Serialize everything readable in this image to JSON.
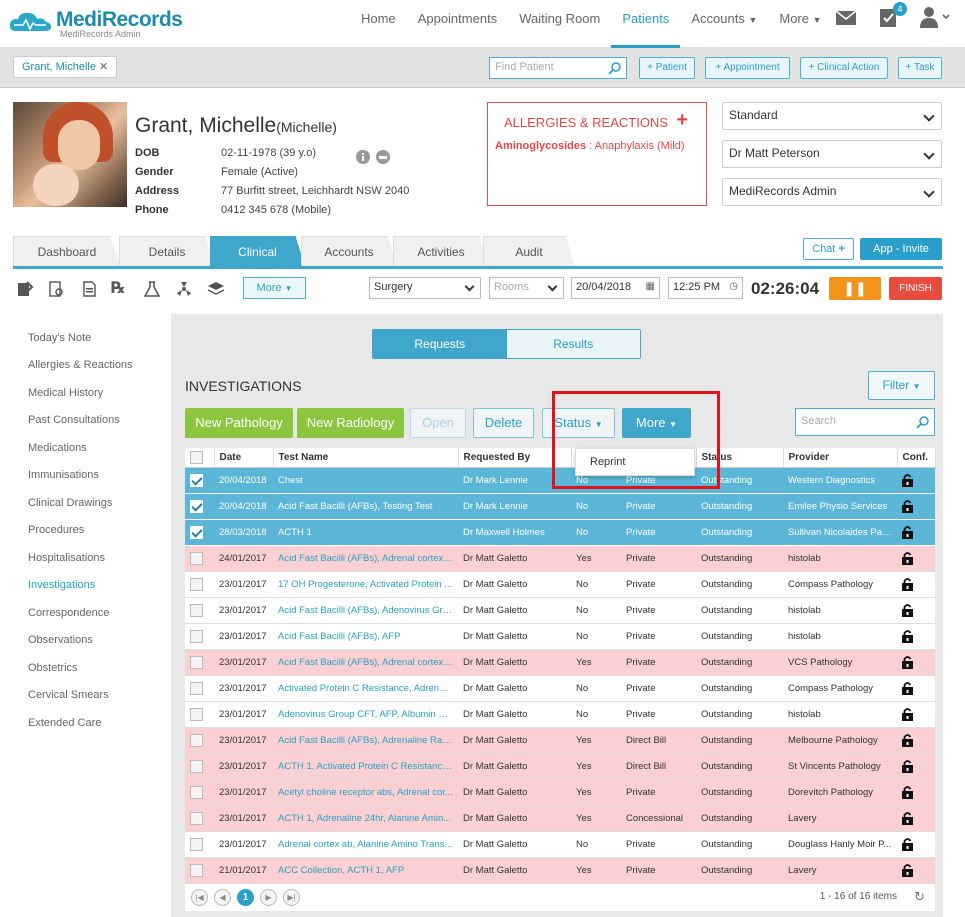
{
  "app": {
    "name": "MediRecords",
    "sub": "MediRecords Admin"
  },
  "nav": {
    "items": [
      "Home",
      "Appointments",
      "Waiting Room",
      "Patients",
      "Accounts",
      "More"
    ],
    "active": "Patients",
    "notifications": "4"
  },
  "bar2": {
    "patient_tab": "Grant, Michelle",
    "find_placeholder": "Find Patient",
    "btn_patient": "+ Patient",
    "btn_appointment": "+ Appointment",
    "btn_clinical": "+ Clinical Action",
    "btn_task": "+ Task"
  },
  "patient": {
    "name": "Grant, Michelle",
    "preferred": "(Michelle)",
    "dob_label": "DOB",
    "dob": "02-11-1978 (39 y.o)",
    "gender_label": "Gender",
    "gender": "Female (Active)",
    "address_label": "Address",
    "address": "77 Burfitt street, Leichhardt NSW 2040",
    "phone_label": "Phone",
    "phone": "0412 345 678 (Mobile)"
  },
  "allergies": {
    "title": "ALLERGIES & REACTIONS",
    "item_name": "Aminoglycosides",
    "item_detail": " : Anaphylaxis (Mild)"
  },
  "selects": {
    "billing": "Standard",
    "doctor": "Dr Matt Peterson",
    "location": "MediRecords Admin"
  },
  "tabs": [
    "Dashboard",
    "Details",
    "Clinical",
    "Accounts",
    "Activities",
    "Audit"
  ],
  "chat_label": "Chat",
  "invite_label": "App - Invite",
  "toolbar": {
    "more": "More",
    "surgery": "Surgery",
    "rooms": "Rooms",
    "date": "20/04/2018",
    "time": "12:25 PM",
    "timer": "02:26:04",
    "finish": "FINISH"
  },
  "sidebar": [
    "Today's Note",
    "Allergies & Reactions",
    "Medical History",
    "Past Consultations",
    "Medications",
    "Immunisations",
    "Clinical Drawings",
    "Procedures",
    "Hospitalisations",
    "Investigations",
    "Correspondence",
    "Observations",
    "Obstetrics",
    "Cervical Smears",
    "Extended Care"
  ],
  "sidebar_active": "Investigations",
  "segment": {
    "requests": "Requests",
    "results": "Results"
  },
  "investigations": {
    "title": "INVESTIGATIONS",
    "filter": "Filter",
    "new_pathology": "New Pathology",
    "new_radiology": "New Radiology",
    "open": "Open",
    "delete": "Delete",
    "status": "Status",
    "more": "More",
    "search_placeholder": "Search",
    "dropdown_item": "Reprint"
  },
  "table": {
    "headers": [
      "",
      "Date",
      "Test Name",
      "Requested By",
      "",
      "",
      "Status",
      "Provider",
      "Conf."
    ],
    "rows": [
      {
        "checked": true,
        "style": "sel-row",
        "date": "20/04/2018",
        "test": "Chest",
        "by": "Dr Mark Lennie",
        "urgent": "No",
        "billing": "Private",
        "status": "Outstanding",
        "provider": "Western Diagnostics"
      },
      {
        "checked": true,
        "style": "sel-row",
        "date": "20/04/2018",
        "test": "Acid Fast Bacilli (AFBs), Testing Test",
        "by": "Dr Mark Lennie",
        "urgent": "No",
        "billing": "Private",
        "status": "Outstanding",
        "provider": "Emilee Physio Services"
      },
      {
        "checked": true,
        "style": "sel-row",
        "date": "28/03/2018",
        "test": "ACTH 1",
        "by": "Dr Maxwell Holmes",
        "urgent": "No",
        "billing": "Private",
        "status": "Outstanding",
        "provider": "Sullivan Nicolaides Pat..."
      },
      {
        "checked": false,
        "style": "pink",
        "date": "24/01/2017",
        "test": "Acid Fast Bacilli (AFBs), Adrenal cortex a...",
        "by": "Dr Matt Galetto",
        "urgent": "Yes",
        "billing": "Private",
        "status": "Outstanding",
        "provider": "histolab"
      },
      {
        "checked": false,
        "style": "white",
        "date": "23/01/2017",
        "test": "17 OH Progesterone, Activated Protein ...",
        "by": "Dr Matt Galetto",
        "urgent": "No",
        "billing": "Private",
        "status": "Outstanding",
        "provider": "Compass Pathology"
      },
      {
        "checked": false,
        "style": "white",
        "date": "23/01/2017",
        "test": "Acid Fast Bacilli (AFBs), Adenovirus Grou...",
        "by": "Dr Matt Galetto",
        "urgent": "No",
        "billing": "Private",
        "status": "Outstanding",
        "provider": "histolab"
      },
      {
        "checked": false,
        "style": "white",
        "date": "23/01/2017",
        "test": "Acid Fast Bacilli (AFBs), AFP",
        "by": "Dr Matt Galetto",
        "urgent": "No",
        "billing": "Private",
        "status": "Outstanding",
        "provider": "histolab"
      },
      {
        "checked": false,
        "style": "pink",
        "date": "23/01/2017",
        "test": "Acid Fast Bacilli (AFBs), Adrenal cortex a...",
        "by": "Dr Matt Galetto",
        "urgent": "Yes",
        "billing": "Private",
        "status": "Outstanding",
        "provider": "VCS Pathology"
      },
      {
        "checked": false,
        "style": "white",
        "date": "23/01/2017",
        "test": "Activated Protein C Resistance, Adrenali...",
        "by": "Dr Matt Galetto",
        "urgent": "No",
        "billing": "Private",
        "status": "Outstanding",
        "provider": "Compass Pathology"
      },
      {
        "checked": false,
        "style": "white",
        "date": "23/01/2017",
        "test": "Adenovirus Group CFT, AFP, Albumin Mi...",
        "by": "Dr Matt Galetto",
        "urgent": "No",
        "billing": "Private",
        "status": "Outstanding",
        "provider": "histolab"
      },
      {
        "checked": false,
        "style": "pink",
        "date": "23/01/2017",
        "test": "Acid Fast Bacilli (AFBs), Adrenaline Rand...",
        "by": "Dr Matt Galetto",
        "urgent": "Yes",
        "billing": "Direct Bill",
        "status": "Outstanding",
        "provider": "Melbourne Pathology"
      },
      {
        "checked": false,
        "style": "pink",
        "date": "23/01/2017",
        "test": "ACTH 1, Activated Protein C Resistance, ...",
        "by": "Dr Matt Galetto",
        "urgent": "Yes",
        "billing": "Direct Bill",
        "status": "Outstanding",
        "provider": "St Vincents Pathology"
      },
      {
        "checked": false,
        "style": "pink",
        "date": "23/01/2017",
        "test": "Acetyl choline receptor abs, Adrenal cor...",
        "by": "Dr Matt Galetto",
        "urgent": "Yes",
        "billing": "Private",
        "status": "Outstanding",
        "provider": "Dorevitch Pathology"
      },
      {
        "checked": false,
        "style": "pink",
        "date": "23/01/2017",
        "test": "ACTH 1, Adrenaline 24hr, Alanine Amin...",
        "by": "Dr Matt Galetto",
        "urgent": "Yes",
        "billing": "Concessional",
        "status": "Outstanding",
        "provider": "Lavery"
      },
      {
        "checked": false,
        "style": "white",
        "date": "23/01/2017",
        "test": "Adrenal cortex ab, Alanine Amino Trans...",
        "by": "Dr Matt Galetto",
        "urgent": "No",
        "billing": "Private",
        "status": "Outstanding",
        "provider": "Douglass Hanly Moir P..."
      },
      {
        "checked": false,
        "style": "pink",
        "date": "21/01/2017",
        "test": "ACC Collection, ACTH 1, AFP",
        "by": "Dr Matt Galetto",
        "urgent": "Yes",
        "billing": "Private",
        "status": "Outstanding",
        "provider": "Lavery"
      }
    ]
  },
  "pager": {
    "current": "1",
    "count": "1 - 16 of 16 items"
  },
  "colors": {
    "accent": "#2a9fc9",
    "pink": "#fbd0d2",
    "selected": "#5bb6d8",
    "green": "#8cc63f",
    "pause": "#f2941c",
    "finish": "#e84c3d"
  }
}
